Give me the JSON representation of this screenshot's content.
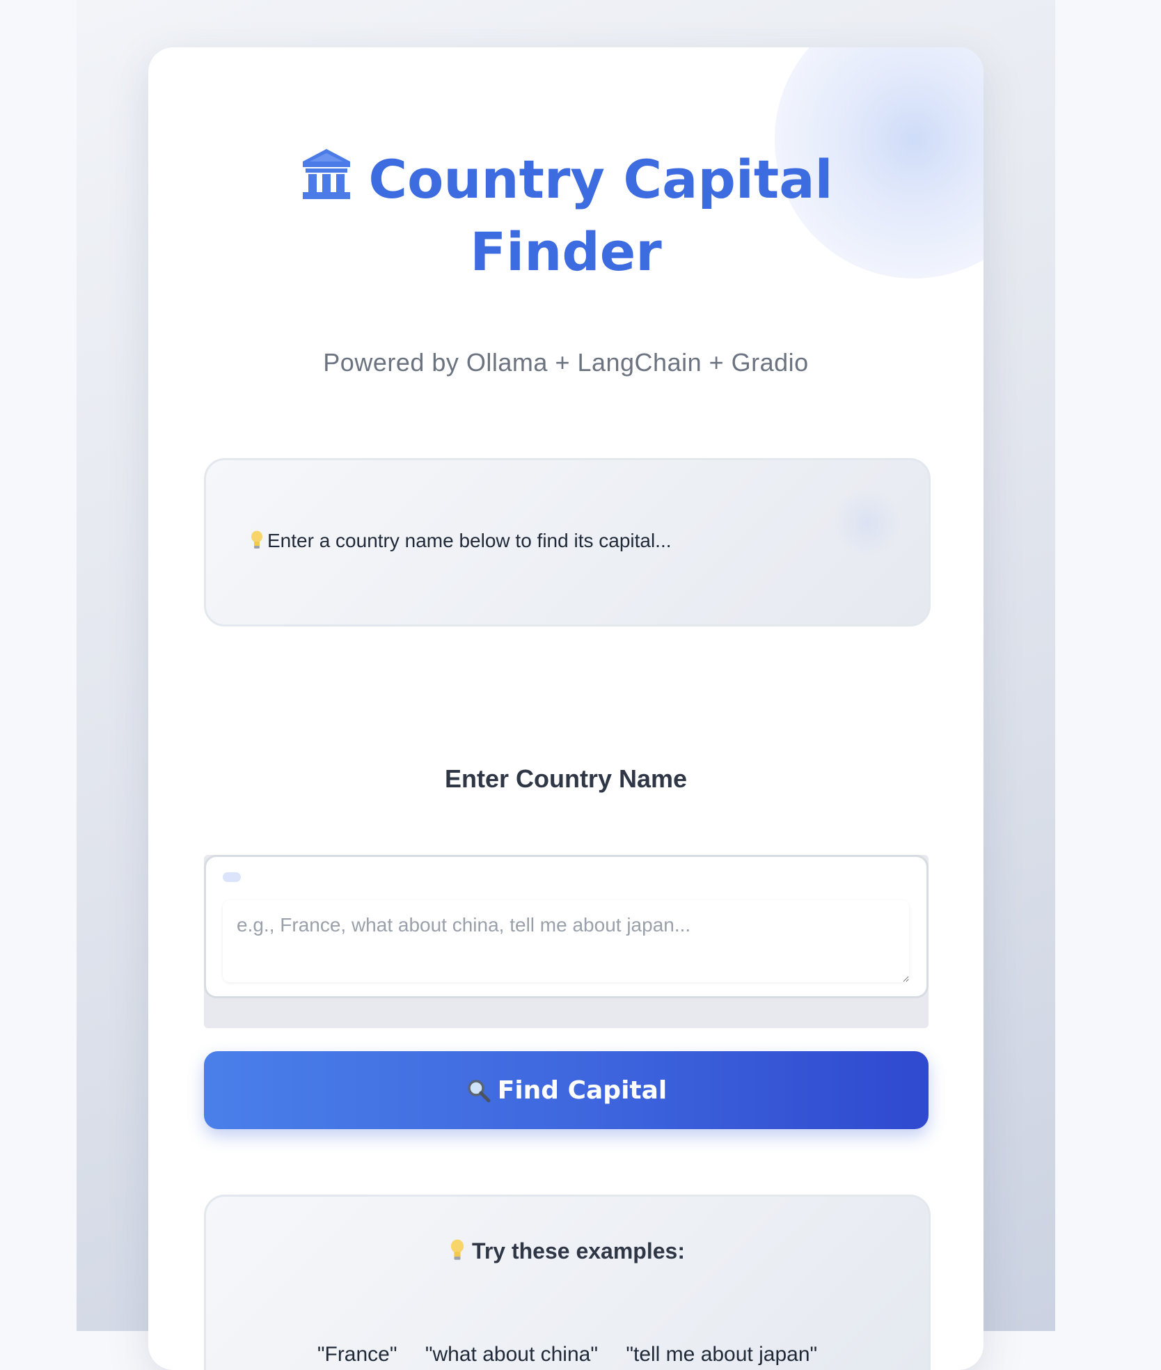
{
  "header": {
    "title_line1": "Country Capital",
    "title_line2": "Finder",
    "subtitle": "Powered by Ollama + LangChain + Gradio"
  },
  "output": {
    "hint_text": "Enter a country name below to find its capital..."
  },
  "form": {
    "label": "Enter Country Name",
    "input_value": "",
    "input_placeholder": "e.g., France, what about china, tell me about japan...",
    "button_label": "Find Capital"
  },
  "examples": {
    "title": "Try these examples:",
    "items": [
      "\"France\"",
      "\"what about china\"",
      "\"tell me about japan\""
    ]
  },
  "colors": {
    "accent": "#3d6be0",
    "button_start": "#4a7fe9",
    "button_end": "#2f49cf"
  },
  "icons": {
    "title_icon": "classical-building-icon",
    "hint_icon": "lightbulb-icon",
    "button_icon": "magnifying-glass-icon",
    "examples_icon": "lightbulb-icon"
  }
}
